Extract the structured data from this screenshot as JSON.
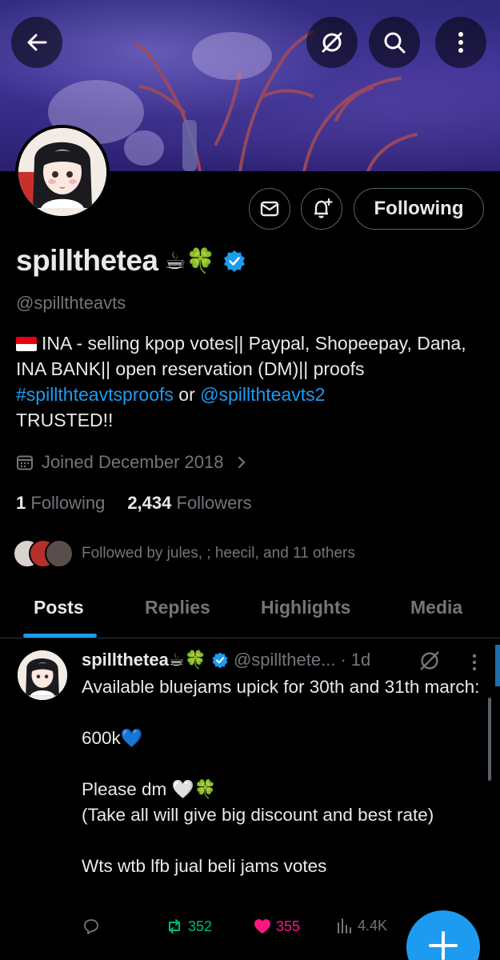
{
  "profile": {
    "display_name": "spillthetea",
    "name_emojis": "☕🍀",
    "handle": "@spillthteavts",
    "bio": {
      "line1": "INA - selling kpop votes|| Paypal, Shopeepay, Dana, INA BANK|| open reservation (DM)|| proofs ",
      "hashtag": "#spillthteavtsproofs",
      "connector": " or ",
      "mention": "@spillthteavts2",
      "line_end": "TRUSTED!!"
    },
    "joined": "Joined December 2018",
    "following_count": "1",
    "following_label": "Following",
    "followers_count": "2,434",
    "followers_label": "Followers",
    "followed_by": "Followed by jules, ; heecil, and 11 others"
  },
  "buttons": {
    "following": "Following"
  },
  "tabs": [
    "Posts",
    "Replies",
    "Highlights",
    "Media"
  ],
  "post": {
    "author": "spillthetea☕🍀",
    "handle": "@spillthete...",
    "separator": "·",
    "time": "1d",
    "text": [
      "Available bluejams upick for 30th and 31th march:",
      "600k💙",
      "Please dm 🤍🍀",
      "(Take all will give big discount and best rate)",
      "Wts wtb lfb jual beli jams votes"
    ],
    "retweets": "352",
    "likes": "355",
    "views": "4.4K"
  },
  "colors": {
    "accent": "#1d9bf0",
    "muted": "#71767b",
    "retweet": "#00ba7c",
    "like": "#f91880"
  }
}
